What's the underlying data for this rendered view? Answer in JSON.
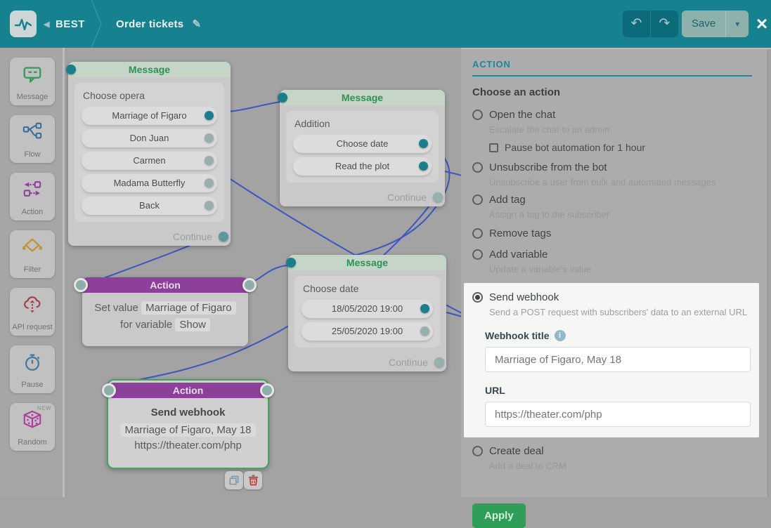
{
  "colors": {
    "brand_teal": "#16818f",
    "message_green": "#2f9054",
    "action_purple": "#8d4099",
    "selected_green": "#43a35f",
    "edge_blue": "#3d55c2",
    "apply_green": "#2f9e58",
    "spotlight_white": "#f6f6f4"
  },
  "icons": {
    "undo": "↶",
    "redo": "↷",
    "edit": "✎",
    "close": "×",
    "back_arrow": "◀",
    "caret": "▾",
    "info": "i"
  },
  "topbar": {
    "back_label": "BEST",
    "title": "Order tickets",
    "save_label": "Save"
  },
  "sidebar": {
    "items": [
      {
        "label": "Message"
      },
      {
        "label": "Flow"
      },
      {
        "label": "Action"
      },
      {
        "label": "Filter"
      },
      {
        "label": "API request"
      },
      {
        "label": "Pause"
      },
      {
        "label": "Random",
        "badge": "NEW"
      }
    ]
  },
  "canvas": {
    "nodes": [
      {
        "title": "Message",
        "label": "Choose opera",
        "buttons": [
          {
            "label": "Marriage of Figaro"
          },
          {
            "label": "Don Juan"
          },
          {
            "label": "Carmen"
          },
          {
            "label": "Madama Butterfly"
          },
          {
            "label": "Back"
          }
        ],
        "footer": "Continue"
      },
      {
        "title": "Message",
        "label": "Addition",
        "buttons": [
          {
            "label": "Choose date"
          },
          {
            "label": "Read the plot"
          }
        ],
        "footer": "Continue"
      },
      {
        "title": "Action",
        "line1_prefix": "Set value",
        "line1_value": "Marriage of Figaro",
        "line2_prefix": "for variable",
        "line2_value": "Show"
      },
      {
        "title": "Message",
        "label": "Choose date",
        "buttons": [
          {
            "label": "18/05/2020 19:00"
          },
          {
            "label": "25/05/2020 19:00"
          }
        ],
        "footer": "Continue"
      },
      {
        "title": "Action",
        "name": "Send webhook",
        "webhook_title": "Marriage of Figaro, May 18",
        "url": "https://theater.com/php"
      }
    ]
  },
  "panel": {
    "header": "ACTION",
    "subheader": "Choose an action",
    "options": [
      {
        "label": "Open the chat",
        "description": "Escalate the chat to an admin",
        "checkbox_label": "Pause bot automation for 1 hour"
      },
      {
        "label": "Unsubscribe from the bot",
        "description": "Unsubscribe a user from bulk and automated messages"
      },
      {
        "label": "Add tag",
        "description": "Assign a tag to the subscriber"
      },
      {
        "label": "Remove tags"
      },
      {
        "label": "Add variable",
        "description": "Update a variable's value"
      },
      {
        "label": "Send webhook",
        "description": "Send a POST request with subscribers' data to an external URL"
      },
      {
        "label": "Create deal",
        "description": "Add a deal to CRM"
      }
    ],
    "webhook_form": {
      "title_label": "Webhook title",
      "title_value": "Marriage of Figaro, May 18",
      "url_label": "URL",
      "url_value": "https://theater.com/php"
    },
    "apply_label": "Apply"
  }
}
